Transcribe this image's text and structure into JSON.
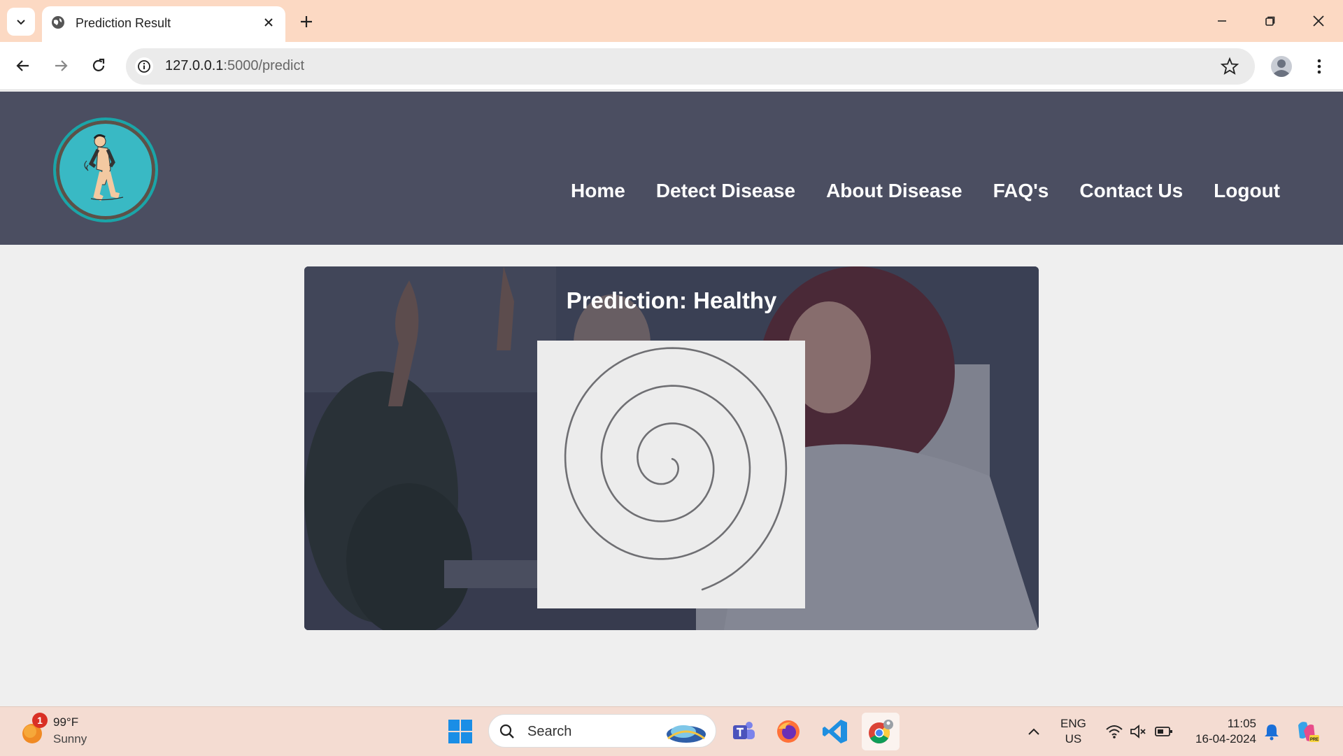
{
  "browser": {
    "tab_title": "Prediction Result",
    "url_host": "127.0.0.1",
    "url_rest": ":5000/predict"
  },
  "site": {
    "nav": [
      "Home",
      "Detect Disease",
      "About Disease",
      "FAQ's",
      "Contact Us",
      "Logout"
    ]
  },
  "result": {
    "title": "Prediction: Healthy"
  },
  "taskbar": {
    "weather_badge": "1",
    "weather_temp": "99°F",
    "weather_condition": "Sunny",
    "search_placeholder": "Search",
    "lang_line1": "ENG",
    "lang_line2": "US",
    "time": "11:05",
    "date": "16-04-2024"
  },
  "colors": {
    "tabstrip": "#fcd9c3",
    "site_header": "#4b4e61",
    "logo_teal": "#39b9c4"
  }
}
